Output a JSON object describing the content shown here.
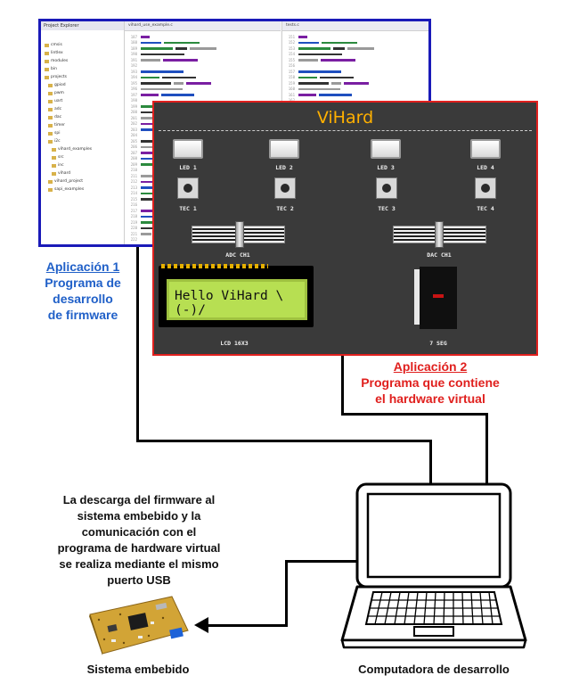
{
  "ide": {
    "explorer_title": "Project Explorer",
    "tab_left": "vihard_use_example.c",
    "tab_right": "tests.c",
    "explorer_items": [
      "cmsis",
      "lintlex",
      "modules",
      "bin",
      "projects",
      "gpiod",
      "pwm",
      "uart",
      "adc",
      "dac",
      "timer",
      "spi",
      "i2c",
      "vihard_examples",
      "src",
      "inc",
      "vihard",
      "vihard_project",
      "sapi_examples"
    ]
  },
  "vihard": {
    "title": "ViHard",
    "leds": [
      "LED 1",
      "LED 2",
      "LED 3",
      "LED 4"
    ],
    "buttons": [
      "TEC 1",
      "TEC 2",
      "TEC 3",
      "TEC 4"
    ],
    "adc_label": "ADC CH1",
    "dac_label": "DAC CH1",
    "lcd_text": "Hello ViHard \\(-)/",
    "lcd_label": "LCD 16X3",
    "seg_label": "7 SEG",
    "colors": {
      "title": "#ffb000",
      "panel": "#3a3a3a",
      "lcd": "#b7df52",
      "border": "#e0201e"
    }
  },
  "captions": {
    "app1_title": "Aplicación 1",
    "app1_lines": [
      "Programa de",
      "desarrollo",
      "de firmware"
    ],
    "app2_title": "Aplicación 2",
    "app2_lines": [
      "Programa que contiene",
      "el hardware virtual"
    ],
    "note_lines": [
      "La descarga del firmware al",
      "sistema embebido y la",
      "comunicación con el",
      "programa de hardware virtual",
      "se realiza mediante el mismo",
      "puerto USB"
    ],
    "board_label": "Sistema embebido",
    "laptop_label": "Computadora de desarrollo"
  },
  "colors": {
    "blue": "#2060c8",
    "red": "#e0201e",
    "ide_border": "#1a1ab8"
  }
}
